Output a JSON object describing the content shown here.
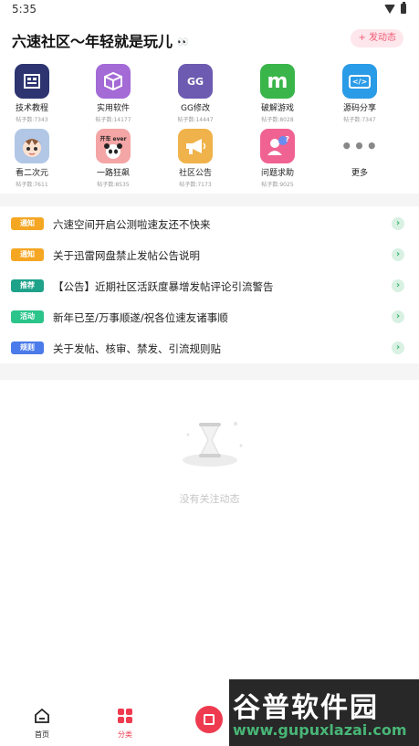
{
  "status_bar": {
    "time": "5:35"
  },
  "header": {
    "title": "六速社区～年轻就是玩儿",
    "title_badge": "👀",
    "post_button": "+ 发动态"
  },
  "categories": [
    {
      "label": "技术教程",
      "count": "帖子数:7343",
      "color": "#2d3470",
      "icon": "book-icon"
    },
    {
      "label": "实用软件",
      "count": "帖子数:14177",
      "color": "#a46ad6",
      "icon": "box-icon"
    },
    {
      "label": "GG修改",
      "count": "帖子数:14447",
      "color": "#6c5bb0",
      "icon": "gg-icon",
      "glyph": "GG"
    },
    {
      "label": "破解游戏",
      "count": "帖子数:8028",
      "color": "#39b54a",
      "icon": "m-icon",
      "glyph": "m"
    },
    {
      "label": "源码分享",
      "count": "帖子数:7347",
      "color": "#2a9be6",
      "icon": "code-icon",
      "glyph": "</>"
    },
    {
      "label": "看二次元",
      "count": "帖子数:7611",
      "color": "#b2c7e6",
      "icon": "anime-icon"
    },
    {
      "label": "一路狂飙",
      "count": "帖子数:8535",
      "color": "#f4a5a5",
      "icon": "panda-icon",
      "glyph": "开车 ever"
    },
    {
      "label": "社区公告",
      "count": "帖子数:7173",
      "color": "#f0b24a",
      "icon": "megaphone-icon"
    },
    {
      "label": "问题求助",
      "count": "帖子数:9025",
      "color": "#f06292",
      "icon": "help-icon",
      "glyph": "?"
    },
    {
      "label": "更多",
      "count": "",
      "color": "#ffffff",
      "icon": "more-icon",
      "glyph": "•••"
    }
  ],
  "notices": [
    {
      "tag": "通知",
      "tag_color": "#f5a623",
      "text": "六速空间开启公测啦速友还不快来"
    },
    {
      "tag": "通知",
      "tag_color": "#f5a623",
      "text": "关于迅雷网盘禁止发帖公告说明"
    },
    {
      "tag": "推荐",
      "tag_color": "#1ea28a",
      "text": "【公告】近期社区活跃度暴增发帖评论引流警告"
    },
    {
      "tag": "活动",
      "tag_color": "#2bc48a",
      "text": "新年已至/万事顺遂/祝各位速友诸事顺"
    },
    {
      "tag": "规则",
      "tag_color": "#4b7bea",
      "text": "关于发帖、核审、禁发、引流规则贴"
    }
  ],
  "empty_state": {
    "text": "没有关注动态"
  },
  "bottom_nav": {
    "home": "首页",
    "category": "分类",
    "active_color": "#ef3b4f"
  },
  "watermark": {
    "title": "谷普软件园",
    "url": "www.gupuxlazai.com"
  }
}
